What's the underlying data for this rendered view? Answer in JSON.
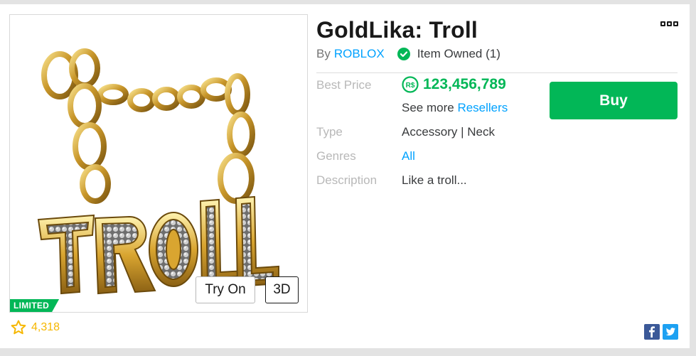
{
  "item": {
    "title": "GoldLika: Troll",
    "by_prefix": "By",
    "creator": "ROBLOX",
    "owned_text": "Item Owned (1)",
    "limited_badge": "LIMITED",
    "favorites": "4,318"
  },
  "viewer": {
    "try_on_label": "Try On",
    "three_d_label": "3D"
  },
  "details": {
    "best_price_label": "Best Price",
    "price": "123,456,789",
    "robux_symbol": "R$",
    "see_more_prefix": "See more",
    "resellers_link": "Resellers",
    "type_label": "Type",
    "type_value": "Accessory | Neck",
    "genres_label": "Genres",
    "genres_value": "All",
    "description_label": "Description",
    "description_value": "Like a troll..."
  },
  "actions": {
    "buy_label": "Buy"
  },
  "colors": {
    "accent_green": "#02b757",
    "link_blue": "#00a2ff",
    "favorite_gold": "#f6b702"
  },
  "icons": [
    "more-options-icon",
    "verified-check-icon",
    "robux-icon",
    "star-icon",
    "facebook-icon",
    "twitter-icon"
  ]
}
